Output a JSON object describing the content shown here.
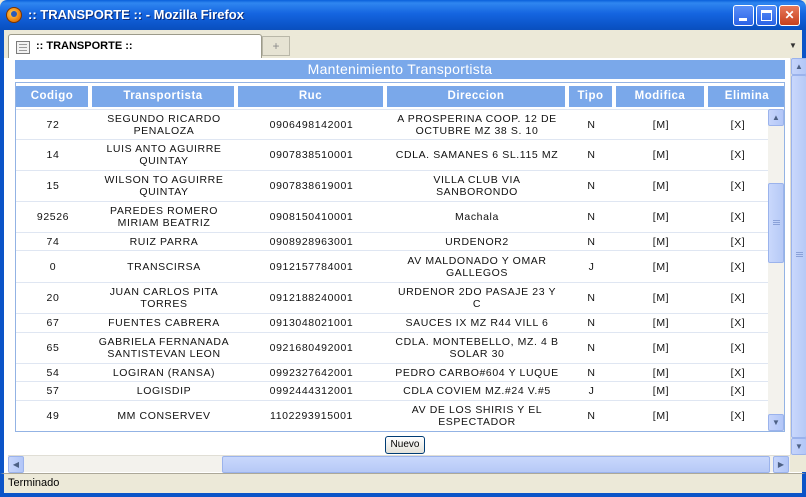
{
  "window": {
    "title": ":: TRANSPORTE :: - Mozilla Firefox"
  },
  "tab": {
    "label": ":: TRANSPORTE ::",
    "new_tab_glyph": "+"
  },
  "page": {
    "heading": "Mantenimiento Transportista",
    "columns": [
      "Codigo",
      "Transportista",
      "Ruc",
      "Direccion",
      "Tipo",
      "Modifica",
      "Elimina"
    ],
    "rows": [
      {
        "codigo": "72",
        "transportista": "SEGUNDO RICARDO PENALOZA",
        "ruc": "0906498142001",
        "direccion": "A PROSPERINA COOP. 12 DE OCTUBRE MZ 38 S. 10",
        "tipo": "N",
        "modifica": "[M]",
        "elimina": "[X]"
      },
      {
        "codigo": "14",
        "transportista": "LUIS ANTO AGUIRRE QUINTAY",
        "ruc": "0907838510001",
        "direccion": "CDLA. SAMANES 6 SL.115 MZ",
        "tipo": "N",
        "modifica": "[M]",
        "elimina": "[X]"
      },
      {
        "codigo": "15",
        "transportista": "WILSON TO AGUIRRE QUINTAY",
        "ruc": "0907838619001",
        "direccion": "VILLA CLUB VIA SANBORONDO",
        "tipo": "N",
        "modifica": "[M]",
        "elimina": "[X]"
      },
      {
        "codigo": "92526",
        "transportista": "PAREDES ROMERO MIRIAM BEATRIZ",
        "ruc": "0908150410001",
        "direccion": "Machala",
        "tipo": "N",
        "modifica": "[M]",
        "elimina": "[X]"
      },
      {
        "codigo": "74",
        "transportista": "RUIZ PARRA",
        "ruc": "0908928963001",
        "direccion": "URDENOR2",
        "tipo": "N",
        "modifica": "[M]",
        "elimina": "[X]"
      },
      {
        "codigo": "0",
        "transportista": "TRANSCIRSA",
        "ruc": "0912157784001",
        "direccion": "AV MALDONADO Y OMAR GALLEGOS",
        "tipo": "J",
        "modifica": "[M]",
        "elimina": "[X]"
      },
      {
        "codigo": "20",
        "transportista": "JUAN CARLOS PITA TORRES",
        "ruc": "0912188240001",
        "direccion": "URDENOR 2DO PASAJE 23 Y C",
        "tipo": "N",
        "modifica": "[M]",
        "elimina": "[X]"
      },
      {
        "codigo": "67",
        "transportista": "FUENTES CABRERA",
        "ruc": "0913048021001",
        "direccion": "SAUCES IX MZ R44 VILL 6",
        "tipo": "N",
        "modifica": "[M]",
        "elimina": "[X]"
      },
      {
        "codigo": "65",
        "transportista": "GABRIELA FERNANADA SANTISTEVAN LEON",
        "ruc": "0921680492001",
        "direccion": "CDLA. MONTEBELLO, MZ. 4 B SOLAR 30",
        "tipo": "N",
        "modifica": "[M]",
        "elimina": "[X]"
      },
      {
        "codigo": "54",
        "transportista": "LOGIRAN (RANSA)",
        "ruc": "0992327642001",
        "direccion": "PEDRO CARBO#604 Y LUQUE",
        "tipo": "N",
        "modifica": "[M]",
        "elimina": "[X]"
      },
      {
        "codigo": "57",
        "transportista": "LOGISDIP",
        "ruc": "0992444312001",
        "direccion": "CDLA COVIEM MZ.#24 V.#5",
        "tipo": "J",
        "modifica": "[M]",
        "elimina": "[X]"
      },
      {
        "codigo": "49",
        "transportista": "MM CONSERVEV",
        "ruc": "1102293915001",
        "direccion": "AV DE LOS SHIRIS Y EL ESPECTADOR",
        "tipo": "N",
        "modifica": "[M]",
        "elimina": "[X]"
      }
    ],
    "new_button": "Nuevo"
  },
  "status": {
    "text": "Terminado"
  },
  "icons": {
    "app": "firefox-icon",
    "tab": "page-icon",
    "minimize": "minimize-icon",
    "maximize": "maximize-icon",
    "close": "close-icon"
  }
}
